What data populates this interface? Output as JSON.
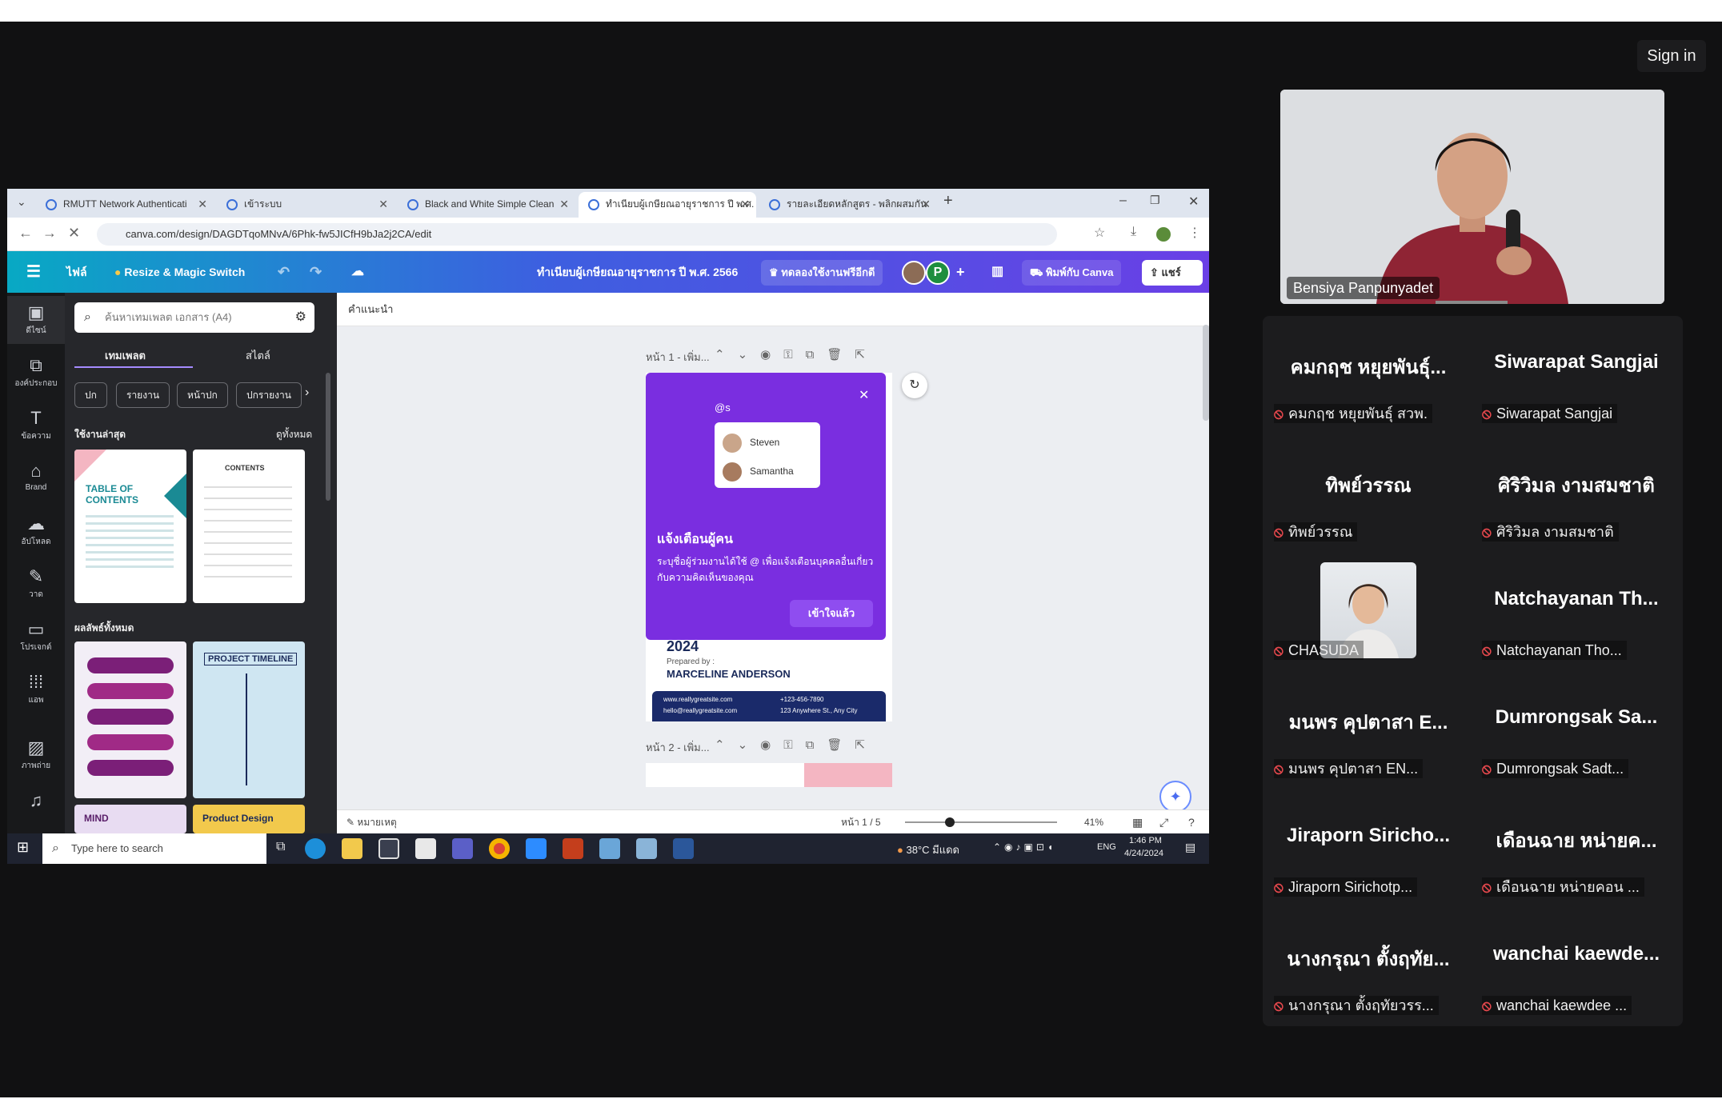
{
  "meeting": {
    "sign_in_label": "Sign in",
    "speaker_name": "Bensiya Panpunyadet"
  },
  "browser": {
    "tabs": [
      {
        "label": "RMUTT Network Authenticati"
      },
      {
        "label": "เข้าระบบ"
      },
      {
        "label": "Black and White Simple Clean"
      },
      {
        "label": "ทำเนียบผู้เกษียณอายุราชการ ปี พ.ศ."
      },
      {
        "label": "รายละเอียดหลักสูตร - พลิกผสมกัน"
      }
    ],
    "new_tab_icon": "+",
    "url": "canva.com/design/DAGDTqoMNvA/6Phk-fw5JICfH9bJa2j2CA/edit"
  },
  "canva": {
    "file_label": "ไฟล์",
    "resize_label": "Resize & Magic Switch",
    "doc_title": "ทำเนียบผู้เกษียณอายุราชการ ปี พ.ศ. 2566",
    "trial_label": "ทดลองใช้งานฟรีอีกดี",
    "avatar_letter": "P",
    "print_label": "พิมพ์กับ Canva",
    "share_label": "แชร์",
    "rail": [
      {
        "label": "ดีไซน์",
        "icon": "layout-icon"
      },
      {
        "label": "องค์ประกอบ",
        "icon": "shapes-icon"
      },
      {
        "label": "ข้อความ",
        "icon": "text-icon"
      },
      {
        "label": "Brand",
        "icon": "brand-icon"
      },
      {
        "label": "อัปโหลด",
        "icon": "upload-icon"
      },
      {
        "label": "วาด",
        "icon": "draw-icon"
      },
      {
        "label": "โปรเจกต์",
        "icon": "folder-icon"
      },
      {
        "label": "แอพ",
        "icon": "apps-icon"
      },
      {
        "label": "ภาพถ่าย",
        "icon": "photo-icon"
      },
      {
        "label": "",
        "icon": "music-icon"
      }
    ],
    "search_placeholder": "ค้นหาเทมเพลต เอกสาร (A4)",
    "panel_tabs": [
      "เทมเพลต",
      "สไตล์"
    ],
    "chips": [
      "ปก",
      "รายงาน",
      "หน้าปก",
      "ปกรายงาน"
    ],
    "recent_label": "ใช้งานล่าสุด",
    "see_all_label": "ดูทั้งหมด",
    "all_results_label": "ผลลัพธ์ทั้งหมด",
    "thumb_texts": [
      "TABLE OF CONTENTS",
      "CONTENTS",
      "PROJECT TIMELINE",
      "MIND",
      "Product Design"
    ],
    "workspace_label": "คำแนะนำ",
    "page1_label": "หน้า 1 - เพิ่ม...",
    "page2_label": "หน้า 2 - เพิ่ม...",
    "popup": {
      "input_text": "@s",
      "mentions": [
        "Steven",
        "Samantha"
      ],
      "title": "แจ้งเตือนผู้คน",
      "body": "ระบุชื่อผู้ร่วมงานได้ใช้ @ เพื่อแจ้งเตือนบุคคลอื่นเกี่ยวกับความคิดเห็นของคุณ",
      "button": "เข้าใจแล้ว"
    },
    "page_year": "2024",
    "prepared_by": "Prepared by :",
    "author": "MARCELINE ANDERSON",
    "contacts": [
      "www.reallygreatsite.com",
      "+123-456-7890",
      "hello@reallygreatsite.com",
      "123 Anywhere St., Any City"
    ],
    "notes_label": "หมายเหตุ",
    "page_counter": "หน้า 1 / 5",
    "zoom": "41%"
  },
  "taskbar": {
    "search_placeholder": "Type here to search",
    "weather": "38°C มีแดด",
    "lang": "ENG",
    "time": "1:46 PM",
    "date": "4/24/2024"
  },
  "participants": [
    {
      "name": "คมกฤช หยุยพันธุ์...",
      "label": "คมกฤช หยุยพันธุ์ สวพ."
    },
    {
      "name": "Siwarapat Sangjai",
      "label": "Siwarapat Sangjai"
    },
    {
      "name": "ทิพย์วรรณ",
      "label": "ทิพย์วรรณ"
    },
    {
      "name": "ศิริวิมล งามสมชาติ",
      "label": "ศิริวิมล งามสมชาติ"
    },
    {
      "name": "",
      "label": "CHASUDA",
      "photo": true
    },
    {
      "name": "Natchayanan Th...",
      "label": "Natchayanan Tho..."
    },
    {
      "name": "มนพร คุปตาสา E...",
      "label": "มนพร คุปตาสา EN..."
    },
    {
      "name": "Dumrongsak Sa...",
      "label": "Dumrongsak Sadt..."
    },
    {
      "name": "Jiraporn Siricho...",
      "label": "Jiraporn Sirichotp..."
    },
    {
      "name": "เดือนฉาย หน่ายค...",
      "label": "เดือนฉาย หน่ายคอน ..."
    },
    {
      "name": "นางกรุณา ตั้งฤทัย...",
      "label": "นางกรุณา ตั้งฤทัยวรร..."
    },
    {
      "name": "wanchai kaewde...",
      "label": "wanchai kaewdee ..."
    }
  ],
  "colors": {
    "mic_muted": "#e5484d",
    "canva_purple": "#7a2ee0",
    "grid_bg": "#1c1c1e"
  }
}
